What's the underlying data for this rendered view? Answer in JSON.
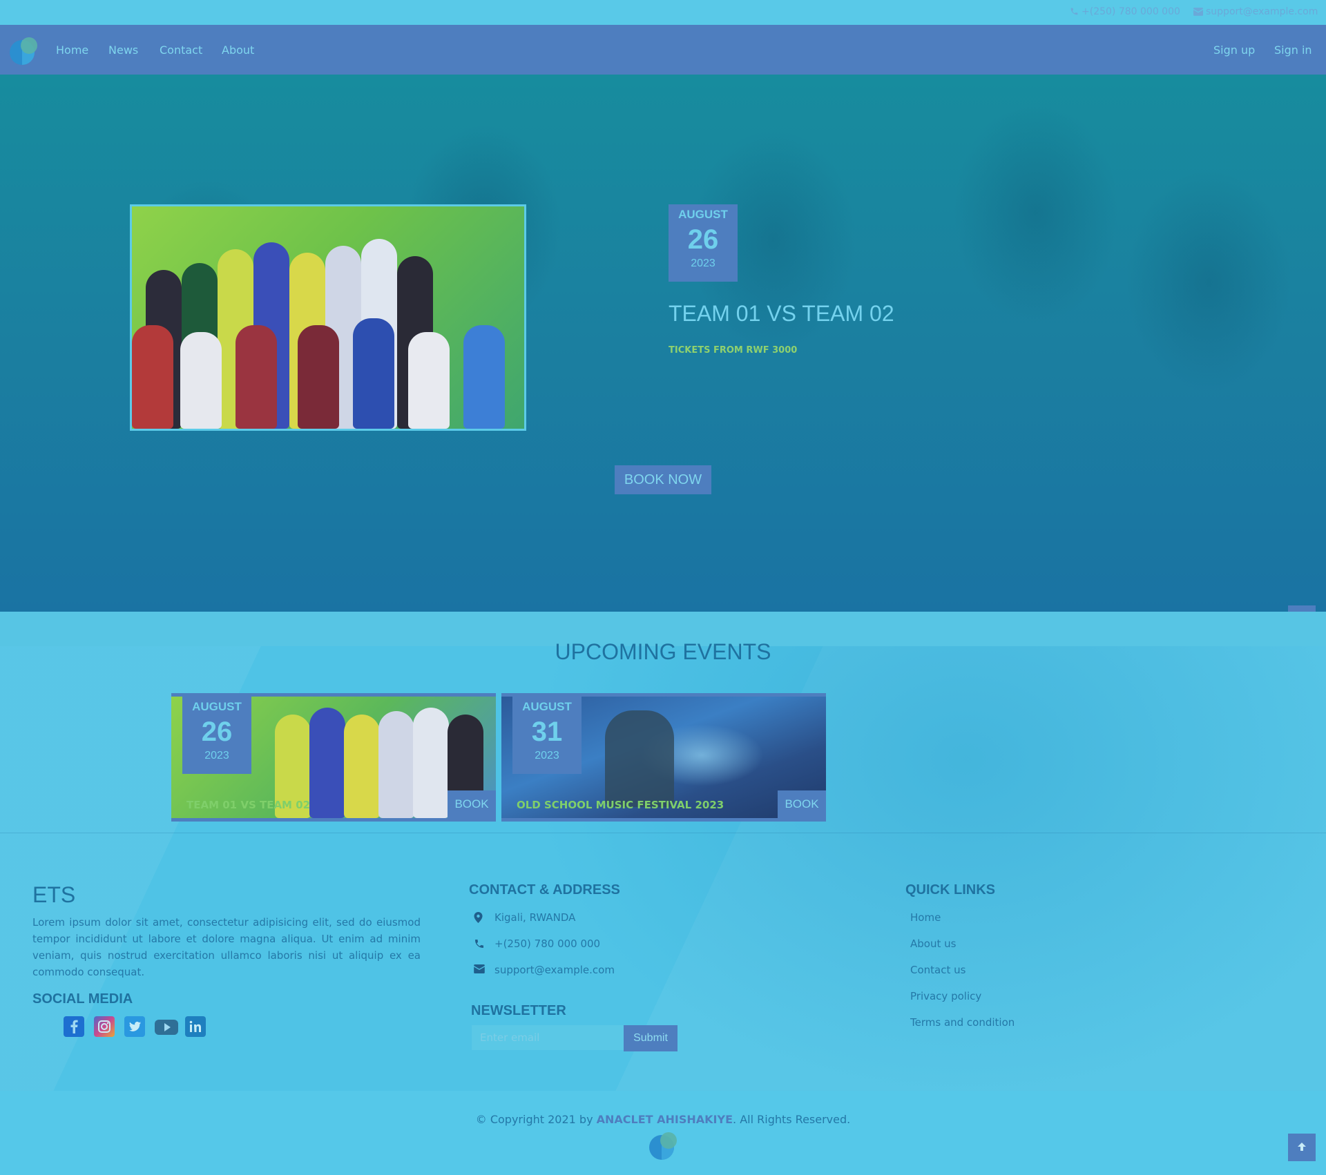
{
  "topbar": {
    "phone": "+(250) 780 000 000",
    "email": "support@example.com"
  },
  "nav": {
    "links": [
      {
        "label": "Home"
      },
      {
        "label": "News"
      },
      {
        "label": "Contact"
      },
      {
        "label": "About"
      }
    ],
    "signup": "Sign up",
    "signin": "Sign in"
  },
  "hero": {
    "date": {
      "month": "AUGUST",
      "day": "26",
      "year": "2023"
    },
    "title": "TEAM 01 VS TEAM 02",
    "subtitle": "TICKETS FROM RWF 3000",
    "cta": "BOOK NOW"
  },
  "upcoming": {
    "title": "UPCOMING EVENTS",
    "events": [
      {
        "month": "AUGUST",
        "day": "26",
        "year": "2023",
        "caption": "TEAM 01 VS TEAM 02",
        "book": "BOOK"
      },
      {
        "month": "AUGUST",
        "day": "31",
        "year": "2023",
        "caption": "OLD SCHOOL MUSIC FESTIVAL 2023",
        "book": "BOOK"
      }
    ]
  },
  "footer": {
    "brand": "ETS",
    "about": "Lorem ipsum dolor sit amet, consectetur adipisicing elit, sed do eiusmod tempor incididunt ut labore et dolore magna aliqua. Ut enim ad minim veniam, quis nostrud exercitation ullamco laboris nisi ut aliquip ex ea commodo consequat.",
    "social_title": "SOCIAL MEDIA",
    "social": [
      "facebook-icon",
      "instagram-icon",
      "twitter-icon",
      "youtube-icon",
      "linkedin-icon"
    ],
    "contact_title": "CONTACT & ADDRESS",
    "address": "Kigali, RWANDA",
    "phone": "+(250) 780 000 000",
    "email": "support@example.com",
    "newsletter_title": "NEWSLETTER",
    "newsletter_placeholder": "Enter email",
    "newsletter_submit": "Submit",
    "quick_title": "QUICK LINKS",
    "quick_links": [
      "Home",
      "About us",
      "Contact us",
      "Privacy policy",
      "Terms and condition"
    ],
    "copyright_prefix": "© Copyright 2021 by ",
    "copyright_author": "ANACLET AHISHAKIYE",
    "copyright_suffix": ". All Rights Reserved."
  },
  "colors": {
    "accent": "#4e7ebf",
    "page_bg": "#4fc3e6",
    "hero_bg": "#1b7fa0",
    "text_blue": "#1f72a0",
    "green_text": "#8fd16e"
  }
}
